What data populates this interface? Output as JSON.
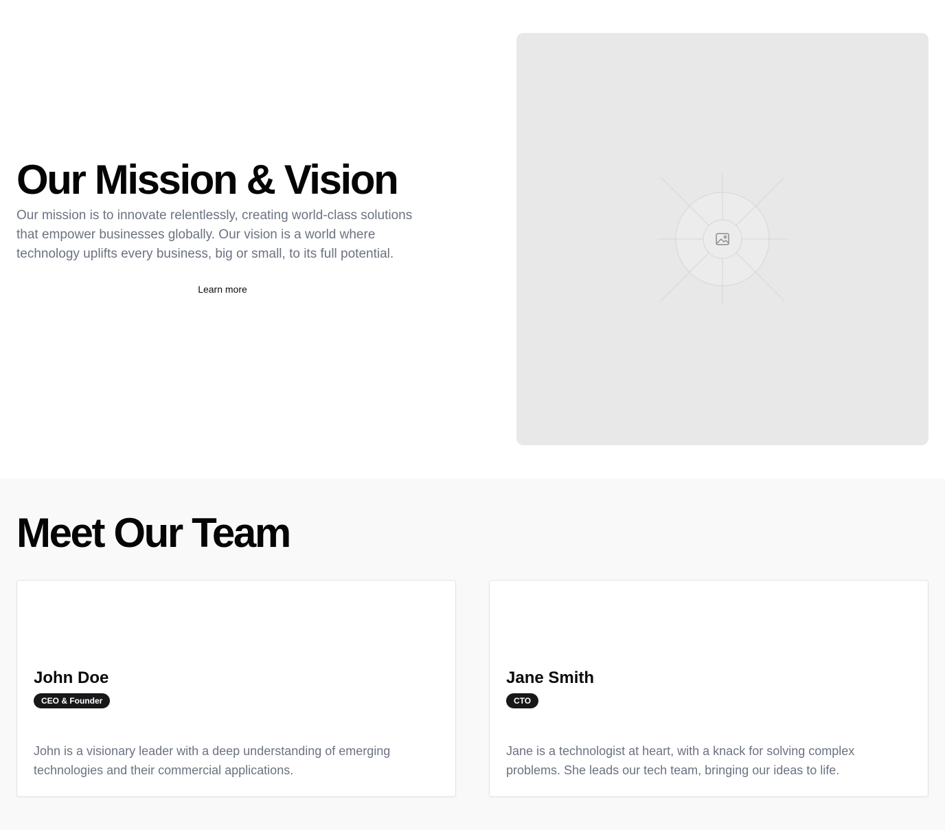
{
  "mission": {
    "title": "Our Mission & Vision",
    "body": "Our mission is to innovate relentlessly, creating world-class solutions that empower businesses globally. Our vision is a world where technology uplifts every business, big or small, to its full potential.",
    "cta_label": "Learn more",
    "image_icon": "image-icon"
  },
  "team": {
    "title": "Meet Our Team",
    "members": [
      {
        "name": "John Doe",
        "role": "CEO & Founder",
        "bio": "John is a visionary leader with a deep understanding of emerging technologies and their commercial applications."
      },
      {
        "name": "Jane Smith",
        "role": "CTO",
        "bio": "Jane is a technologist at heart, with a knack for solving complex problems. She leads our tech team, bringing our ideas to life."
      }
    ]
  },
  "colors": {
    "heading": "#050505",
    "body_text": "#6b7280",
    "placeholder_bg": "#e8e8e8",
    "team_bg": "#f9f9f9",
    "badge_bg": "#18181b",
    "badge_text": "#ffffff"
  }
}
